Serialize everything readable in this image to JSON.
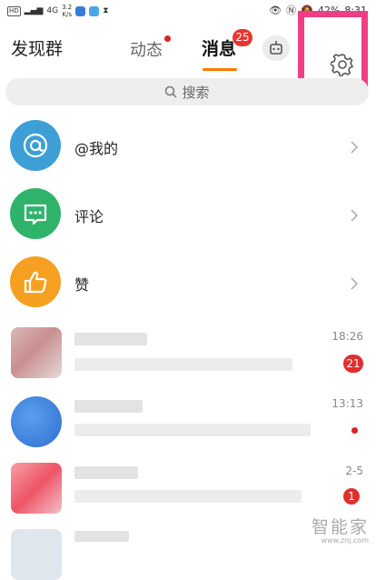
{
  "status_bar": {
    "hd_badge": "HD",
    "net": "4G",
    "speed": "3.2\nK/s",
    "battery": "42%",
    "time": "8:31"
  },
  "header": {
    "title": "发现群",
    "tab_dynamic": "动态",
    "tab_messages": "消息",
    "messages_badge": "25"
  },
  "search": {
    "placeholder": "搜索"
  },
  "categories": [
    {
      "label": "@我的",
      "icon": "at-icon",
      "color": "#3d9fd6"
    },
    {
      "label": "评论",
      "icon": "comment-icon",
      "color": "#2fb36b"
    },
    {
      "label": "赞",
      "icon": "thumbs-up-icon",
      "color": "#f5a021"
    }
  ],
  "chats": [
    {
      "time": "18:26",
      "badge": "21"
    },
    {
      "time": "13:13",
      "badge": ""
    },
    {
      "time": "2-5",
      "badge": "1"
    }
  ],
  "watermark": {
    "name": "智能家",
    "url": "www.znj.com"
  },
  "colors": {
    "accent": "#ff7a00",
    "badge": "#e8352e",
    "highlight": "#ef3e86"
  }
}
